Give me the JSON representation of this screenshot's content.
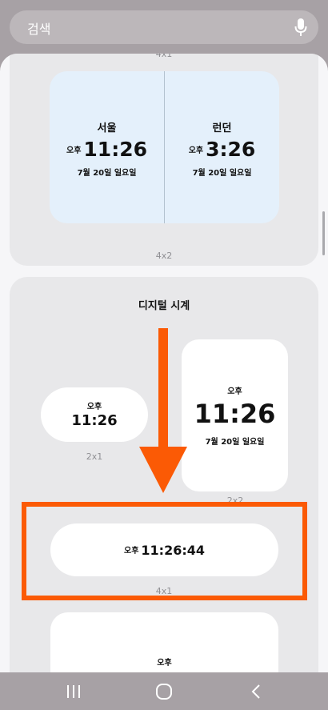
{
  "search": {
    "placeholder": "검색"
  },
  "top_widget": {
    "cities": [
      {
        "name": "서울",
        "ampm": "오후",
        "time": "11:26",
        "date": "7월 20일 일요일"
      },
      {
        "name": "런던",
        "ampm": "오후",
        "time": "3:26",
        "date": "7월 20일 일요일"
      }
    ],
    "size_label_above": "4x1",
    "size_label": "4x2"
  },
  "section": {
    "title": "디지털 시계",
    "widgets": [
      {
        "ampm": "오후",
        "time": "11:26",
        "size_label": "2x1"
      },
      {
        "ampm": "오후",
        "time": "11:26",
        "date": "7월 20일 일요일",
        "size_label": "2x2"
      },
      {
        "ampm": "오후",
        "time": "11:26:44",
        "size_label": "4x1"
      },
      {
        "ampm": "오후"
      }
    ]
  },
  "annotation": {
    "color": "#fb5a05"
  }
}
